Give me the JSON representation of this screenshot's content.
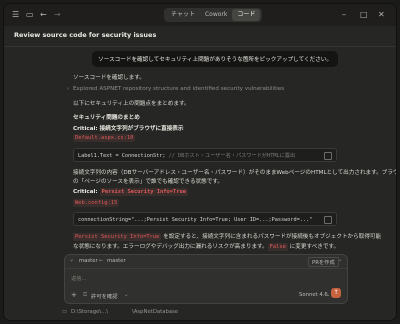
{
  "titlebar": {
    "tabs": [
      "チャット",
      "Cowork",
      "コード"
    ],
    "active_tab": "コード",
    "icons": [
      "sidebar-menu-icon",
      "panel-icon",
      "back-arrow-icon",
      "forward-arrow-icon"
    ]
  },
  "topbar": {
    "title": "Review source code for security issues"
  },
  "messages": {
    "user_prompt": "ソースコードを確認してセキュリティ上問題がありそうな箇所をピックアップしてください。",
    "ack": "ソースコードを確認します。",
    "explored": "Explored ASPNET repository structure and identified security vulnerabilities",
    "intro": "以下にセキュリティ上の問題点をまとめます。",
    "heading": "セキュリティ問題のまとめ",
    "issue1_label": "Critical: 接続文字列がブラウザに直接表示",
    "issue1_file": "Default.aspx.cs:10",
    "issue1_code": "Label1.Text = ConnectionStr;",
    "issue1_comment": "// DBホスト・ユーザー名・パスワードがHTMLに露出",
    "issue1_desc_line1": "接続文字列の内容（DBサーバーアドレス・ユーザー名・パスワード）がそのままWebページのHTMLとして出力されます。ブラウザ",
    "issue1_desc_line2": "の「ページのソースを表示」で誰でも確認できる状態です。",
    "issue2_prefix": "Critical: ",
    "issue2_code_label": "Persist Security Info=True",
    "issue2_file": "Web.config:15",
    "issue2_code": "connectionString=\"...;Persist Security Info=True; User ID=...;Password=...\"",
    "issue2_desc_code": "Persist Security Info=True",
    "issue2_desc_line1": " を設定すると、接続文字列に含まれるパスワードが接続後もオブジェクトから取得可能",
    "issue2_desc_line2": "な状態になります。エラーログやデバッグ出力に漏れるリスクが高まります。",
    "issue2_desc_false": "False",
    "issue2_desc_tail": " に変更すべきです。"
  },
  "composer": {
    "branch_from": "master",
    "arrow": "←",
    "branch_to": "master",
    "pr_button": "PRを作成",
    "placeholder": "返信...",
    "add_symbol": "+",
    "permission_label": "許可を確認",
    "model_label": "Sonnet 4.6",
    "send_symbol": "↑"
  },
  "statusbar": {
    "path_left": "D:\\Storage\\...\\",
    "path_right": "\\AspNetDatabase"
  },
  "colors": {
    "accent": "#c7643f",
    "code_red": "#e05a5a"
  }
}
